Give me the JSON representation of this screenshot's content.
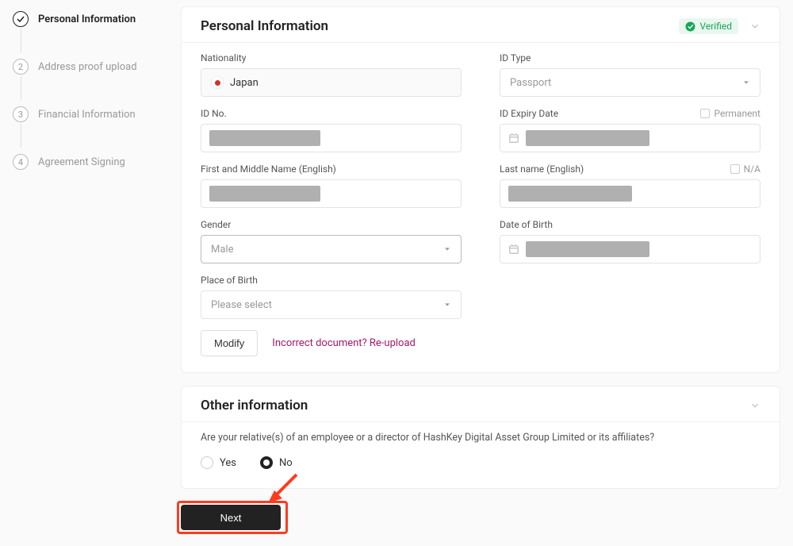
{
  "stepper": {
    "items": [
      {
        "label": "Personal Information",
        "state": "active-complete"
      },
      {
        "label": "Address proof upload",
        "state": "pending",
        "num": "2"
      },
      {
        "label": "Financial Information",
        "state": "pending",
        "num": "3"
      },
      {
        "label": "Agreement Signing",
        "state": "pending",
        "num": "4"
      }
    ]
  },
  "personal": {
    "title": "Personal Information",
    "verified_label": "Verified",
    "nationality_label": "Nationality",
    "nationality_value": "Japan",
    "id_type_label": "ID Type",
    "id_type_value": "Passport",
    "id_no_label": "ID No.",
    "id_expiry_label": "ID Expiry Date",
    "permanent_label": "Permanent",
    "first_name_label": "First and Middle Name (English)",
    "last_name_label": "Last name (English)",
    "na_label": "N/A",
    "gender_label": "Gender",
    "gender_value": "Male",
    "dob_label": "Date of Birth",
    "pob_label": "Place of Birth",
    "pob_placeholder": "Please select",
    "modify_label": "Modify",
    "reupload_label": "Incorrect document? Re-upload"
  },
  "other": {
    "title": "Other information",
    "question": "Are your relative(s) of an employee or a director of HashKey Digital Asset Group Limited or its affiliates?",
    "yes_label": "Yes",
    "no_label": "No",
    "selected": "no"
  },
  "next": {
    "label": "Next"
  }
}
